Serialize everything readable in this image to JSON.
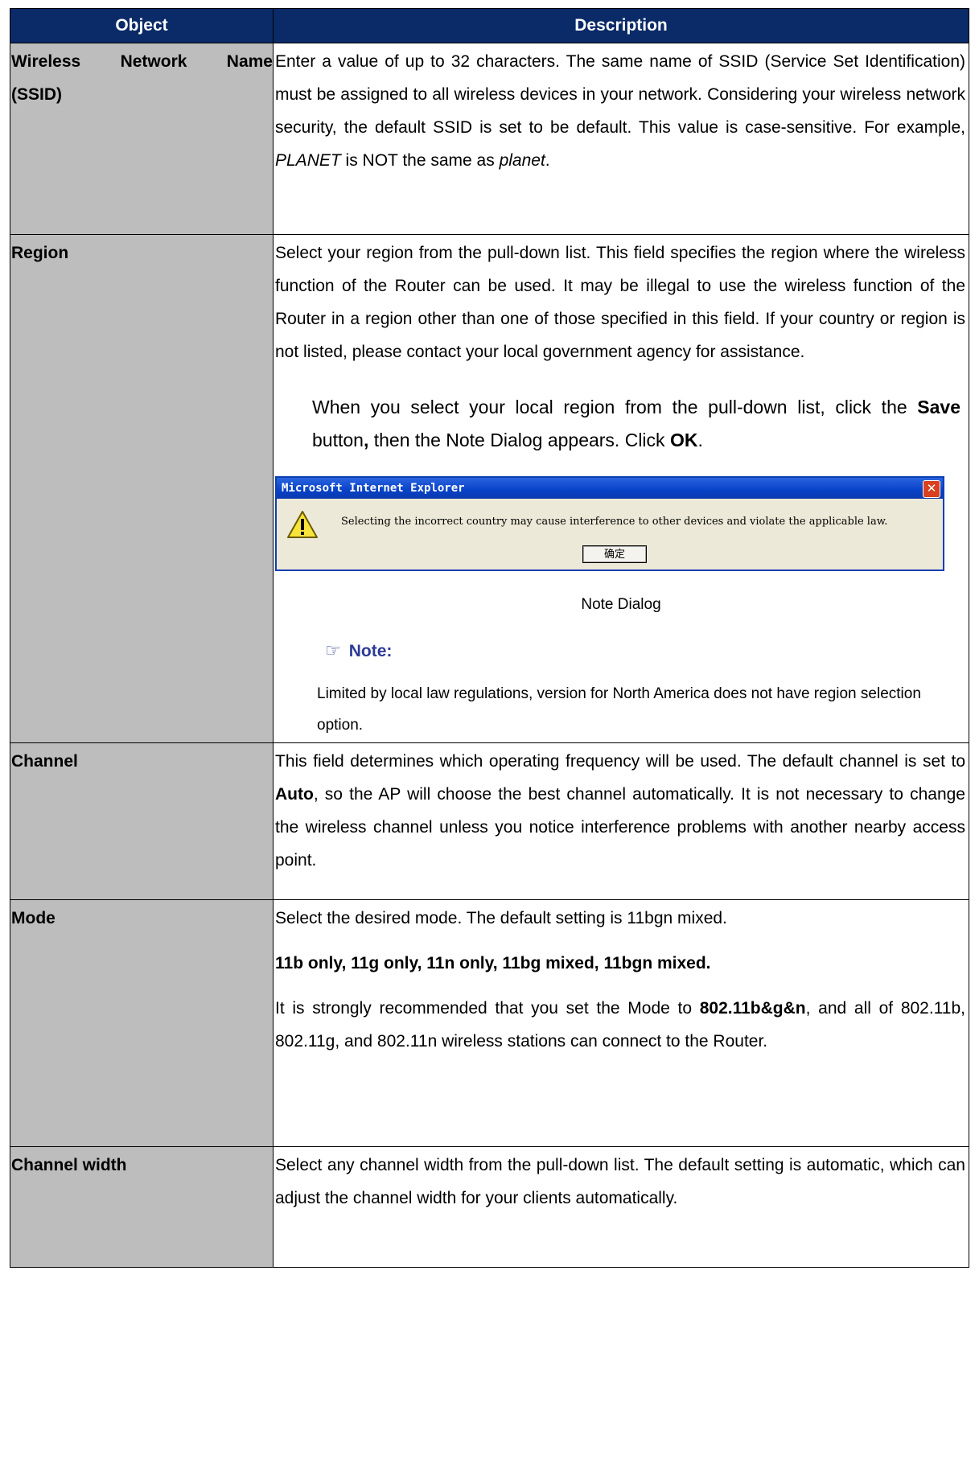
{
  "header": {
    "col1": "Object",
    "col2": "Description"
  },
  "rows": {
    "ssid": {
      "object_line1": "Wireless Network Name",
      "object_line2": "(SSID)",
      "desc_part1": "Enter a value of up to 32 characters. The same name of SSID (Service Set Identification) must be assigned to all wireless devices in your network. Considering your wireless network security, the default SSID is set to be default. This value is case-sensitive. For example, ",
      "desc_italic1": "PLANET",
      "desc_part2": " is NOT the same as ",
      "desc_italic2": "planet",
      "desc_part3": "."
    },
    "region": {
      "object": "Region",
      "desc": "Select your region from the pull-down list. This field specifies the region where the wireless function of the Router can be used. It may be illegal to use the wireless function of the Router in a region other than one of those specified in this field. If your country or region is not listed, please contact your local government agency for assistance.",
      "indent_part1": "When you select your local region from the pull-down list, click the ",
      "indent_bold1": "Save",
      "indent_part2": " button",
      "indent_bold2": ",",
      "indent_part3": " then the Note Dialog appears. Click ",
      "indent_bold3": "OK",
      "indent_part4": ".",
      "dialog": {
        "title": "Microsoft Internet Explorer",
        "close_glyph": "✕",
        "message": "Selecting the incorrect country may cause interference to other devices and violate the applicable law.",
        "ok_label": "确定"
      },
      "caption": "Note Dialog",
      "note_glyph": "☞",
      "note_label": "Note:",
      "note_text": "Limited by local law regulations, version for North America does not have region selection option."
    },
    "channel": {
      "object": "Channel",
      "desc_part1": "This field determines which operating frequency will be used. The default channel is set to ",
      "desc_bold": "Auto",
      "desc_part2": ", so the AP will choose the best channel automatically. It is not necessary to change the wireless channel unless you notice interference problems with another nearby access point."
    },
    "mode": {
      "object": "Mode",
      "desc1": "Select the desired mode. The default setting is 11bgn mixed.",
      "desc2_bold": "11b only, 11g only, 11n only, 11bg mixed, 11bgn mixed.",
      "desc3_part1": "It is strongly recommended that you set the Mode to ",
      "desc3_bold": "802.11b&g&n",
      "desc3_part2": ", and all of 802.11b, 802.11g, and 802.11n wireless stations can connect to the Router."
    },
    "channel_width": {
      "object": "Channel width",
      "desc": "Select any channel width from the pull-down list. The default setting is automatic, which can adjust the channel width for your clients automatically."
    }
  },
  "colors": {
    "header_bg": "#0a2a68",
    "object_bg": "#bdbdbd",
    "note_color": "#2b3a93"
  }
}
